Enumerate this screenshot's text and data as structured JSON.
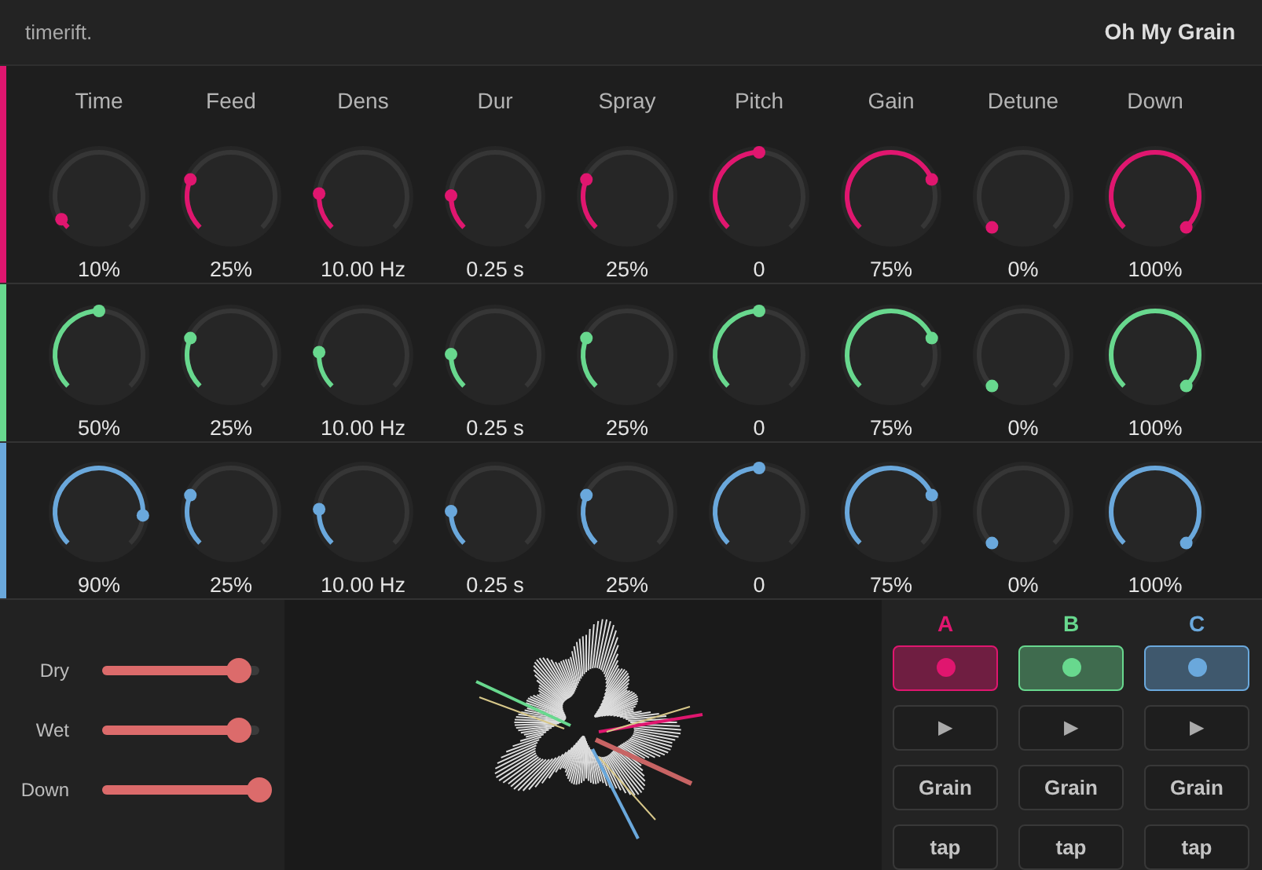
{
  "header": {
    "brand": "timerift.",
    "title": "Oh My Grain"
  },
  "params": [
    "Time",
    "Feed",
    "Dens",
    "Dur",
    "Spray",
    "Pitch",
    "Gain",
    "Detune",
    "Down"
  ],
  "voices": [
    {
      "color": "#e0166f",
      "knobs": [
        {
          "value": "10%"
        },
        {
          "value": "25%"
        },
        {
          "value": "10.00 Hz"
        },
        {
          "value": "0.25 s"
        },
        {
          "value": "25%"
        },
        {
          "value": "0"
        },
        {
          "value": "75%"
        },
        {
          "value": "0%"
        },
        {
          "value": "100%"
        }
      ]
    },
    {
      "color": "#68d88e",
      "knobs": [
        {
          "value": "50%"
        },
        {
          "value": "25%"
        },
        {
          "value": "10.00 Hz"
        },
        {
          "value": "0.25 s"
        },
        {
          "value": "25%"
        },
        {
          "value": "0"
        },
        {
          "value": "75%"
        },
        {
          "value": "0%"
        },
        {
          "value": "100%"
        }
      ]
    },
    {
      "color": "#6aa8dc",
      "knobs": [
        {
          "value": "90%"
        },
        {
          "value": "25%"
        },
        {
          "value": "10.00 Hz"
        },
        {
          "value": "0.25 s"
        },
        {
          "value": "25%"
        },
        {
          "value": "0"
        },
        {
          "value": "75%"
        },
        {
          "value": "0%"
        },
        {
          "value": "100%"
        }
      ]
    }
  ],
  "mix": [
    {
      "label": "Dry",
      "level": 0.87
    },
    {
      "label": "Wet",
      "level": 0.87
    },
    {
      "label": "Down",
      "level": 1
    }
  ],
  "voice_controls": [
    {
      "label": "A",
      "color": "#e0166f",
      "play": "▶",
      "grain": "Grain",
      "tap": "tap"
    },
    {
      "label": "B",
      "color": "#68d88e",
      "play": "▶",
      "grain": "Grain",
      "tap": "tap"
    },
    {
      "label": "C",
      "color": "#6aa8dc",
      "play": "▶",
      "grain": "Grain",
      "tap": "tap"
    }
  ]
}
